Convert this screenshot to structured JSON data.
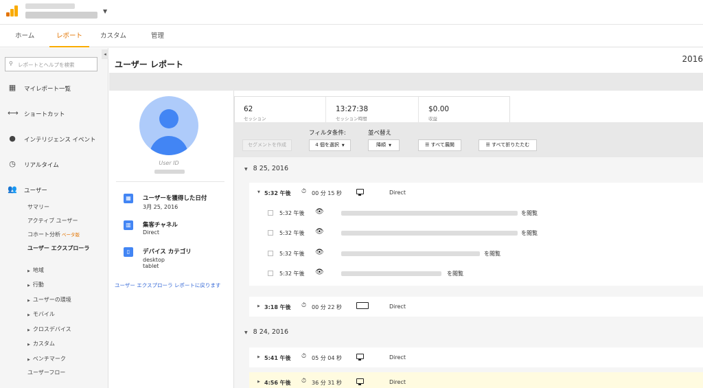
{
  "header": {
    "account_caret": "▼"
  },
  "tabs": [
    {
      "label": "ホーム"
    },
    {
      "label": "レポート"
    },
    {
      "label": "カスタム"
    },
    {
      "label": "管理"
    }
  ],
  "sidebar": {
    "collapse": "◂",
    "search_placeholder": "レポートとヘルプを検索",
    "nav": [
      {
        "label": "マイレポート一覧",
        "icon": "grid-icon"
      },
      {
        "label": "ショートカット",
        "icon": "shortcut-arrows-icon"
      },
      {
        "label": "インテリジェンス イベント",
        "icon": "lightbulb-icon"
      },
      {
        "label": "リアルタイム",
        "icon": "clock-icon"
      },
      {
        "label": "ユーザー",
        "icon": "people-icon"
      }
    ],
    "sub": {
      "summary": "サマリー",
      "active": "アクティブ ユーザー",
      "cohort": "コホート分析",
      "beta": "ベータ版",
      "explorer": "ユーザー エクスプローラ",
      "geo": "地域",
      "behavior": "行動",
      "environment": "ユーザーの環境",
      "mobile": "モバイル",
      "crossdevice": "クロスデバイス",
      "custom": "カスタム",
      "benchmark": "ベンチマーク",
      "flow": "ユーザーフロー"
    }
  },
  "main": {
    "title": "ユーザー レポート",
    "date_fragment": "2016"
  },
  "profile": {
    "user_id_label": "User ID",
    "acquired_title": "ユーザーを獲得した日付",
    "acquired_value": "3月 25, 2016",
    "channel_title": "集客チャネル",
    "channel_value": "Direct",
    "device_title": "デバイス カテゴリ",
    "device_value_1": "desktop",
    "device_value_2": "tablet",
    "back_link": "ユーザー エクスプローラ レポートに戻ります"
  },
  "stats": [
    {
      "value": "62",
      "label": "セッション"
    },
    {
      "value": "13:27:38",
      "label": "セッション時間"
    },
    {
      "value": "$0.00",
      "label": "収益"
    }
  ],
  "filters": {
    "filter_label": "フィルタ条件:",
    "sort_label": "並べ替え",
    "segment_btn": "セグメントを作成",
    "filter_select": "4 個を選択",
    "sort_select": "降順",
    "expand_all": "すべて展開",
    "collapse_all": "すべて折りたたむ"
  },
  "timeline": {
    "date1": "8 25, 2016",
    "date2": "8 24, 2016",
    "s1": {
      "time": "5:32 午後",
      "duration": "00 分 15 秒",
      "channel": "Direct"
    },
    "hits": [
      {
        "time": "5:32 午後",
        "action": "を閲覧"
      },
      {
        "time": "5:32 午後",
        "action": "を閲覧"
      },
      {
        "time": "5:32 午後",
        "action": "を閲覧"
      },
      {
        "time": "5:32 午後",
        "action": "を閲覧"
      }
    ],
    "s2": {
      "time": "3:18 午後",
      "duration": "00 分 22 秒",
      "channel": "Direct"
    },
    "s3": {
      "time": "5:41 午後",
      "duration": "05 分 04 秒",
      "channel": "Direct"
    },
    "s4": {
      "time": "4:56 午後",
      "duration": "36 分 31 秒",
      "channel": "Direct"
    }
  }
}
